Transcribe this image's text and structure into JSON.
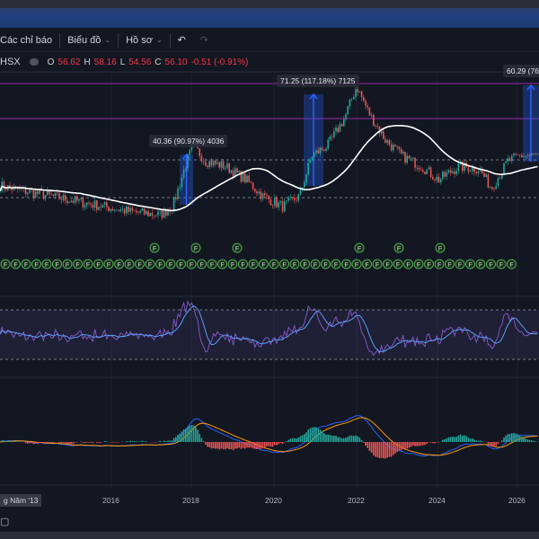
{
  "toolbar": {
    "indicators": "Các chỉ báo",
    "chart": "Biểu đồ",
    "profile": "Hồ sơ",
    "undo_icon": "undo-icon",
    "redo_icon": "redo-icon"
  },
  "legend": {
    "symbol": "HSX",
    "open_label": "O",
    "open": "56.62",
    "high_label": "H",
    "high": "58.16",
    "low_label": "L",
    "low": "54.56",
    "close_label": "C",
    "close": "56.10",
    "change": "-0.51 (-0.91%)"
  },
  "annotations": [
    {
      "text": "40.36 (90.97%) 4036"
    },
    {
      "text": "71.25 (117.18%) 7125"
    },
    {
      "text": "60.29 (76"
    }
  ],
  "time_axis": {
    "current": "g Năm '13",
    "ticks": [
      "2016",
      "2018",
      "2020",
      "2022",
      "2024",
      "2026"
    ]
  },
  "marker_label": "F",
  "colors": {
    "up": "#26a69a",
    "down": "#ef5350",
    "ma": "#ffffff",
    "rsi": "#7e57c2",
    "macd": "#2962ff",
    "signal": "#ff9800",
    "marker": "#4caf50"
  },
  "chart_data": {
    "type": "candlestick",
    "x_unit": "year",
    "close_keypoints": [
      [
        2012.7,
        35
      ],
      [
        2013.5,
        32
      ],
      [
        2014.5,
        29
      ],
      [
        2015.5,
        26
      ],
      [
        2016.5,
        23
      ],
      [
        2017.2,
        22
      ],
      [
        2017.5,
        25
      ],
      [
        2017.8,
        40
      ],
      [
        2018.0,
        48
      ],
      [
        2018.3,
        42
      ],
      [
        2018.8,
        40
      ],
      [
        2019.3,
        35
      ],
      [
        2019.7,
        29
      ],
      [
        2020.2,
        25
      ],
      [
        2020.6,
        29
      ],
      [
        2020.9,
        44
      ],
      [
        2021.3,
        48
      ],
      [
        2021.7,
        58
      ],
      [
        2022.0,
        70
      ],
      [
        2022.3,
        60
      ],
      [
        2022.7,
        50
      ],
      [
        2023.1,
        44
      ],
      [
        2023.6,
        40
      ],
      [
        2024.0,
        35
      ],
      [
        2024.5,
        40
      ],
      [
        2025.0,
        39
      ],
      [
        2025.3,
        32
      ],
      [
        2025.7,
        42
      ],
      [
        2026.0,
        44
      ]
    ],
    "levels": [
      71.25,
      60.29
    ]
  }
}
